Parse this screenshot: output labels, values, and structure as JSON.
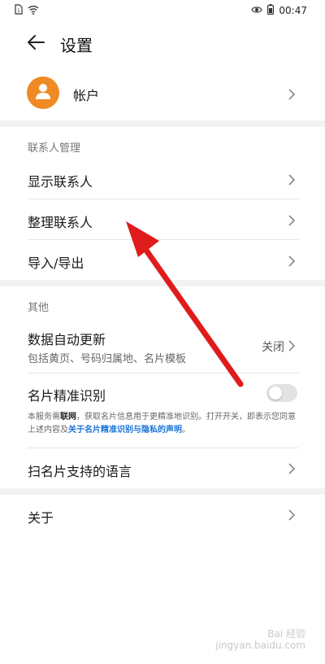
{
  "status_bar": {
    "time": "00:47"
  },
  "header": {
    "title": "设置"
  },
  "account": {
    "label": "帐户"
  },
  "contacts_section": {
    "header": "联系人管理",
    "items": [
      {
        "label": "显示联系人"
      },
      {
        "label": "整理联系人"
      },
      {
        "label": "导入/导出"
      }
    ]
  },
  "other_section": {
    "header": "其他",
    "auto_update": {
      "label": "数据自动更新",
      "subtitle": "包括黄页、号码归属地、名片模板",
      "value": "关闭"
    },
    "card_recognition": {
      "label": "名片精准识别",
      "toggle_on": false
    },
    "notice": {
      "part1": "本服务需",
      "bold": "联网",
      "part2": "，获取名片信息用于更精准地识别。打开开关，即表示您同意上述内容及",
      "link": "关于名片精准识别与隐私的声明",
      "end": "。"
    },
    "languages": {
      "label": "扫名片支持的语言"
    }
  },
  "about": {
    "label": "关于"
  },
  "watermark": {
    "line1": "Bai 经验",
    "line2": "jingyan.baidu.com"
  },
  "colors": {
    "avatar": "#f08a24",
    "arrow": "#e01b1b",
    "link": "#1a73d9"
  },
  "icons": [
    "sim-icon",
    "wifi-icon",
    "eye-icon",
    "battery-icon",
    "back-arrow-icon",
    "person-icon",
    "chevron-right-icon"
  ]
}
